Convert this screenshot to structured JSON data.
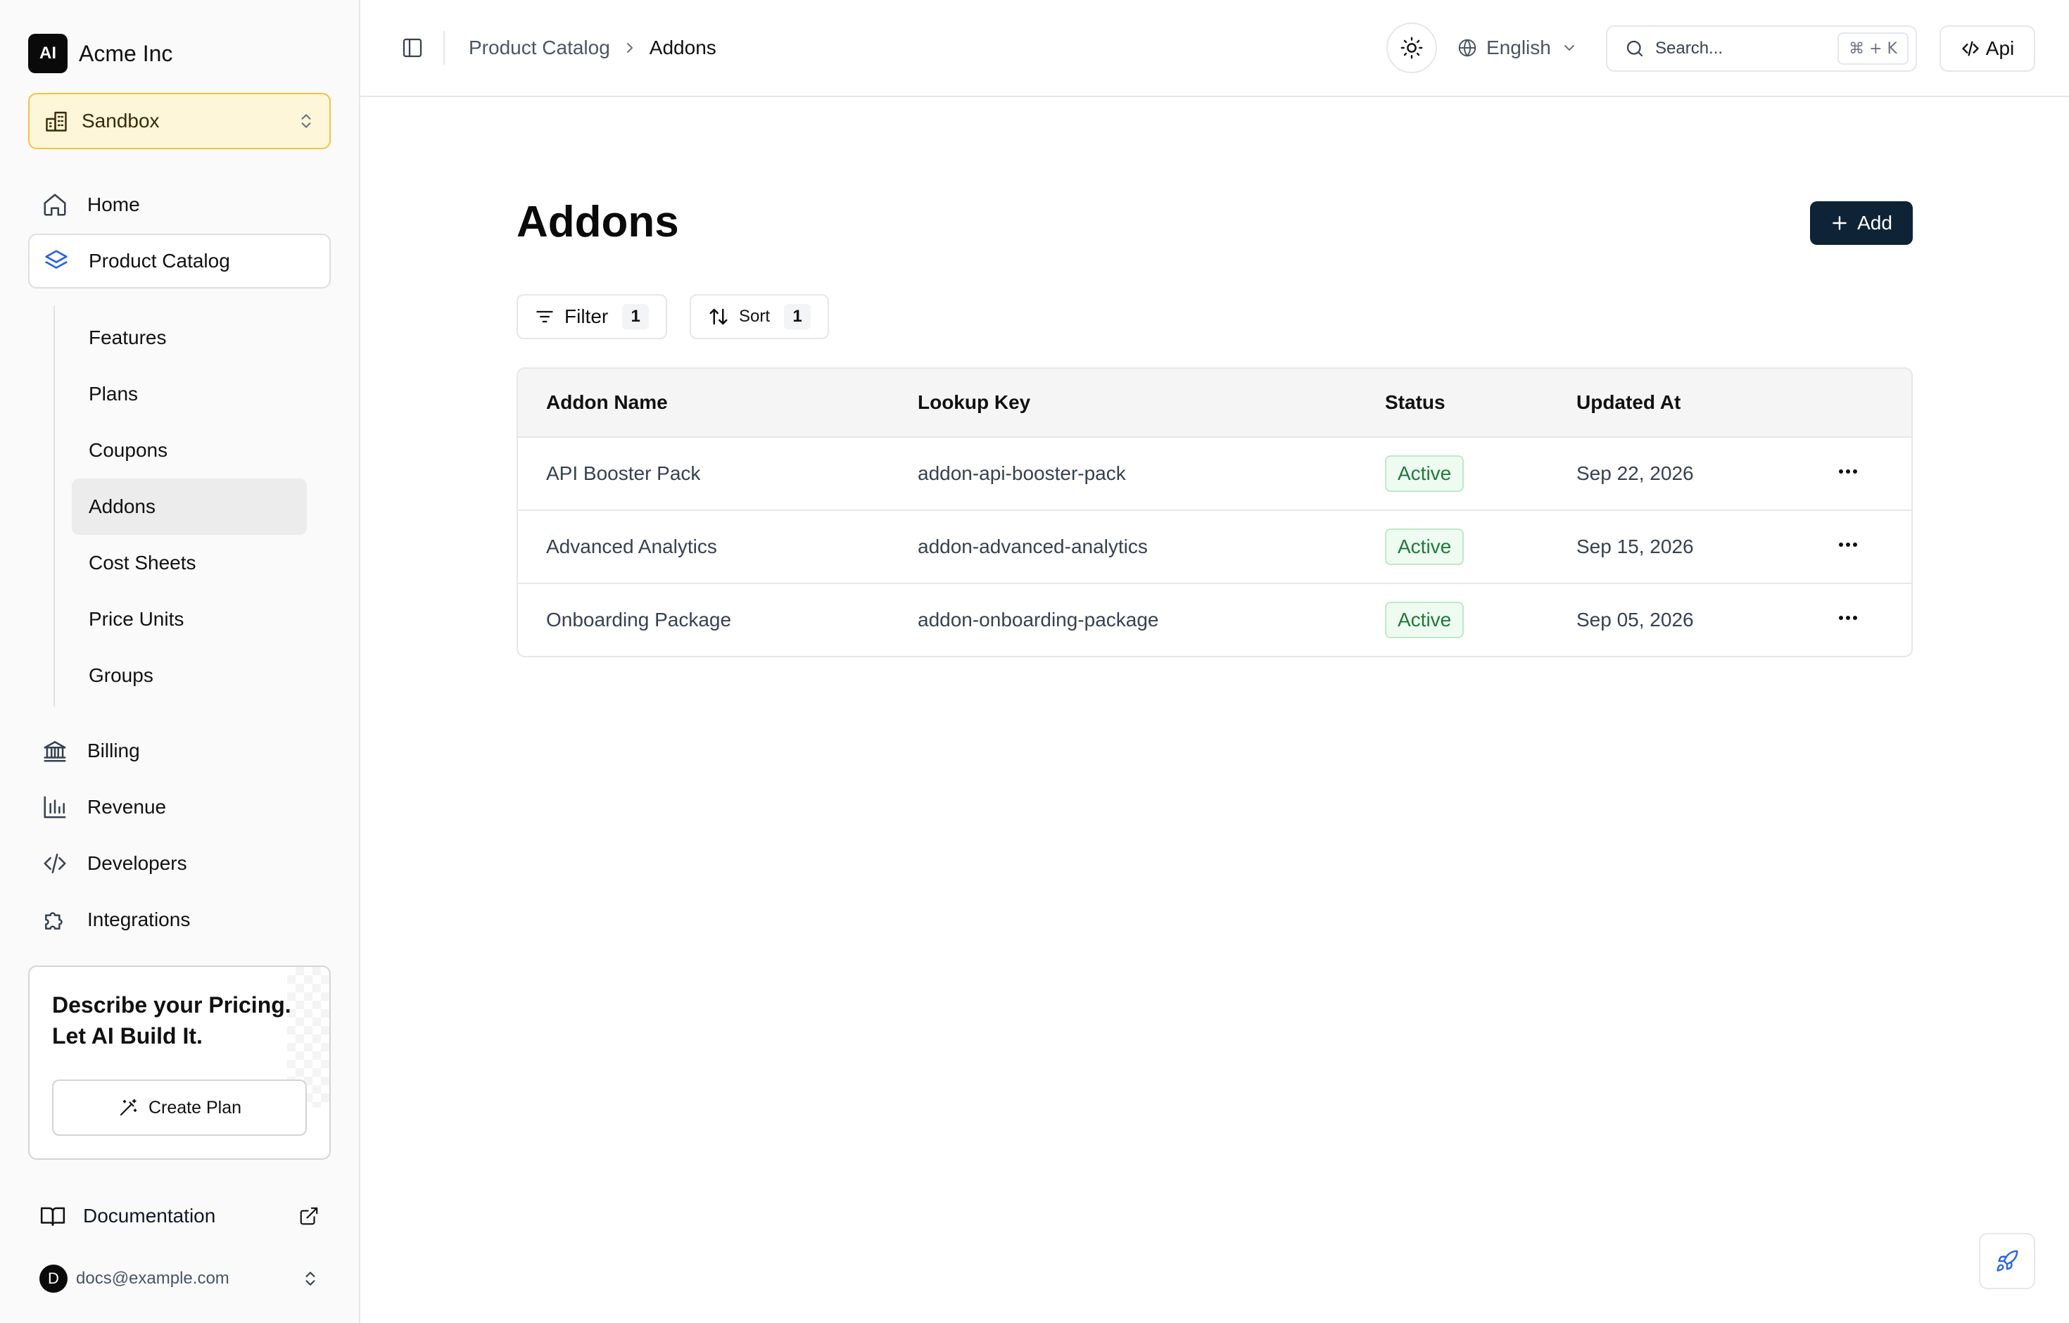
{
  "brand": {
    "logo_text": "AI",
    "name": "Acme Inc"
  },
  "environment": {
    "label": "Sandbox"
  },
  "nav": {
    "home": "Home",
    "product_catalog": "Product Catalog",
    "sub_items": [
      "Features",
      "Plans",
      "Coupons",
      "Addons",
      "Cost Sheets",
      "Price Units",
      "Groups"
    ],
    "active_sub_item": "Addons",
    "billing": "Billing",
    "revenue": "Revenue",
    "developers": "Developers",
    "integrations": "Integrations"
  },
  "promo": {
    "title": "Describe your Pricing. Let AI Build It.",
    "button_label": "Create Plan"
  },
  "documentation": {
    "label": "Documentation"
  },
  "user": {
    "avatar_initial": "D",
    "email": "docs@example.com"
  },
  "topbar": {
    "breadcrumb": {
      "parent": "Product Catalog",
      "current": "Addons"
    },
    "language": "English",
    "search": {
      "placeholder": "Search...",
      "shortcut": "⌘ + K"
    },
    "api_label": "Api"
  },
  "page": {
    "title": "Addons",
    "add_label": "Add",
    "filter": {
      "label": "Filter",
      "count": "1"
    },
    "sort": {
      "label": "Sort",
      "count": "1"
    }
  },
  "table": {
    "columns": [
      "Addon Name",
      "Lookup Key",
      "Status",
      "Updated At"
    ],
    "rows": [
      {
        "name": "API Booster Pack",
        "lookup_key": "addon-api-booster-pack",
        "status": "Active",
        "updated_at": "Sep 22, 2026"
      },
      {
        "name": "Advanced Analytics",
        "lookup_key": "addon-advanced-analytics",
        "status": "Active",
        "updated_at": "Sep 15, 2026"
      },
      {
        "name": "Onboarding Package",
        "lookup_key": "addon-onboarding-package",
        "status": "Active",
        "updated_at": "Sep 05, 2026"
      }
    ]
  },
  "colors": {
    "accent_dark": "#0f2336",
    "status_active_text": "#1f7a3c",
    "status_active_bg": "#eefbf1",
    "environment_bg": "#fef6d9",
    "environment_border": "#f5c242",
    "product_catalog_icon": "#2563eb"
  },
  "icons": {
    "environment": "building-icon",
    "home": "home-icon",
    "product_catalog": "layers-icon",
    "billing": "bank-icon",
    "revenue": "bar-chart-icon",
    "developers": "code-icon",
    "integrations": "puzzle-icon",
    "promo_button": "magic-wand-icon",
    "documentation": "book-icon",
    "external_link": "external-link-icon",
    "theme": "sun-icon",
    "language": "globe-icon",
    "search": "search-icon",
    "api": "code-icon",
    "add": "plus-icon",
    "filter": "filter-icon",
    "sort": "sort-icon",
    "row_actions": "ellipsis-icon",
    "floating": "rocket-icon"
  }
}
